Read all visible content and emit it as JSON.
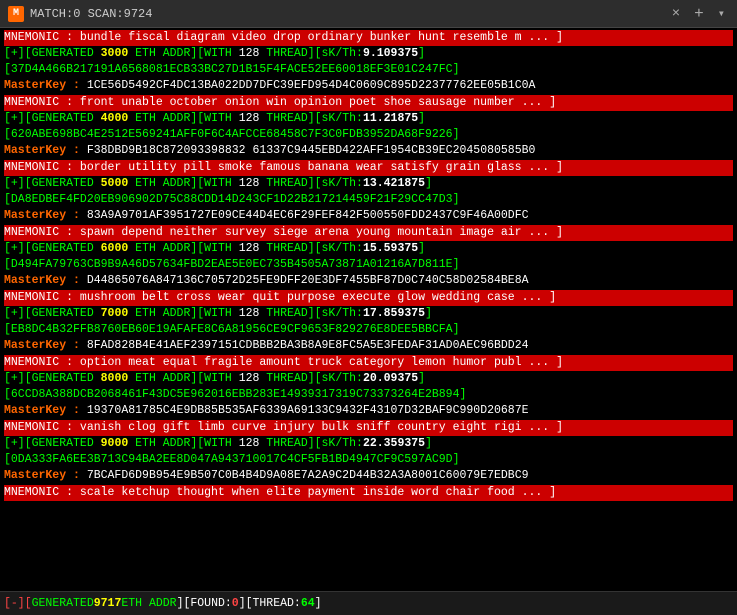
{
  "titlebar": {
    "icon": "M",
    "title": "MATCH:0 SCAN:9724",
    "close": "×",
    "plus": "+",
    "dropdown": "▾"
  },
  "statusbar": {
    "prefix": "[-][",
    "generated_label": " GENERATED ",
    "scan_num": "9717",
    "eth_label": " ETH ADDR ",
    "found_label": "][FOUND:",
    "found_val": "0",
    "thread_label": "][THREAD:",
    "thread_val": "64",
    "suffix": "]"
  },
  "blocks": [
    {
      "mnemonic": "MNEMONIC : bundle fiscal diagram video drop ordinary bunker hunt resemble m ... ]",
      "generated": "[+][GENERATED 3000 ETH ADDR][WITH 128 THREAD][sK/Th:9.109375]",
      "addr": "[37D4A466B217191A6568081ECB33BC27D1B15F4FACE52EE60018EF3E01C247FC]",
      "masterkey": "MasterKey :  1CE56D5492CF4DC13BA022DD7DFC39EFD954D4C0609C895D22377762EE05B1C0A"
    },
    {
      "mnemonic": "MNEMONIC : front unable october onion win opinion poet shoe sausage number ... ]",
      "generated": "[+][GENERATED 4000 ETH ADDR][WITH 128 THREAD][sK/Th:11.21875]",
      "addr": "[620ABE698BC4E2512E569241AFF0F6C4AFCCE68458C7F3C0FDB3952DA68F9226]",
      "masterkey": "MasterKey :  F38DBD9B18C872093398832 61337C9445EBD422AFF1954CB39EC2045080585B0"
    },
    {
      "mnemonic": "MNEMONIC : border utility pill smoke famous banana wear satisfy grain glass ... ]",
      "generated": "[+][GENERATED 5000 ETH ADDR][WITH 128 THREAD][sK/Th:13.421875]",
      "addr": "[DA8EDBEF4FD20EB906902D75C88CDD14D243CF1D22B217214459F21F29CC47D3]",
      "masterkey": "MasterKey :  83A9A9701AF3951727E09CE44D4EC6F29FEF842F500550FDD2437C9F46A00DFC"
    },
    {
      "mnemonic": "MNEMONIC : spawn depend neither survey siege arena young mountain image air ... ]",
      "generated": "[+][GENERATED 6000 ETH ADDR][WITH 128 THREAD][sK/Th:15.59375]",
      "addr": "[D494FA79763CB9B9A46D57634FBD2EAE5E0EC735B4505A73871A01216A7D811E]",
      "masterkey": "MasterKey :  D44865076A847136C70572D25FE9DFF20E3DF7455BF87D0C740C58D02584BE8A"
    },
    {
      "mnemonic": "MNEMONIC : mushroom belt cross wear quit purpose execute glow wedding case ... ]",
      "generated": "[+][GENERATED 7000 ETH ADDR][WITH 128 THREAD][sK/Th:17.859375]",
      "addr": "[EB8DC4B32FFB8760EB60E19AFAFE8C6A81956CE9CF9653F829276E8DEE5BBCFA]",
      "masterkey": "MasterKey :  8FAD828B4E41AEF2397151CDBBB2BA3B8A9E8FC5A5E3FEDAF31AD0AEC96BDD24"
    },
    {
      "mnemonic": "MNEMONIC : option meat equal fragile amount truck category lemon humor publ ... ]",
      "generated": "[+][GENERATED 8000 ETH ADDR][WITH 128 THREAD][sK/Th:20.09375]",
      "addr": "[6CCD8A388DCB2068461F43DC5E962016EBB283E14939317319C73373264E2B894]",
      "masterkey": "MasterKey :  19370A81785C4E9DB85B535AF6339A69133C9432F43107D32BAF9C990D20687E"
    },
    {
      "mnemonic": "MNEMONIC : vanish clog gift limb curve injury bulk sniff country eight rigi ... ]",
      "generated": "[+][GENERATED 9000 ETH ADDR][WITH 128 THREAD][sK/Th:22.359375]",
      "addr": "[0DA333FA6EE3B713C94BA2EE8D047A943710017C4CF5FB1BD4947CF9C597AC9D]",
      "masterkey": "MasterKey :  7BCAFD6D9B954E9B507C0B4B4D9A08E7A2A9C2D44B32A3A8001C60079E7EDBC9"
    },
    {
      "mnemonic": "MNEMONIC : scale ketchup thought when elite payment inside word chair food ... ]",
      "generated": "",
      "addr": "",
      "masterkey": ""
    }
  ]
}
